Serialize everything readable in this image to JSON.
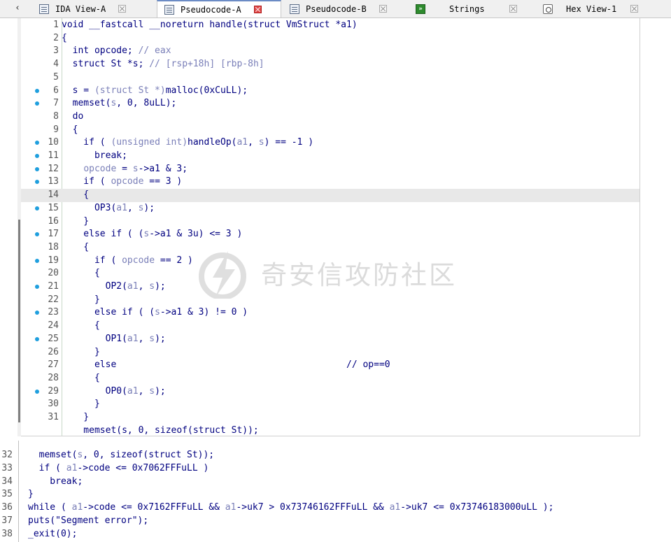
{
  "tabs": [
    {
      "label": "IDA View-A",
      "icon": "doc-icon",
      "active": false
    },
    {
      "label": "Pseudocode-A",
      "icon": "doc-icon",
      "active": true
    },
    {
      "label": "Pseudocode-B",
      "icon": "doc-icon",
      "active": false
    },
    {
      "label": "Strings",
      "icon": "strings-icon",
      "active": false
    },
    {
      "label": "Hex View-1",
      "icon": "hex-icon",
      "active": false
    }
  ],
  "editor": {
    "lines": [
      {
        "n": "1",
        "dot": false,
        "segs": [
          [
            "void __fastcall __noreturn handle(struct VmStruct *a1)",
            "d"
          ]
        ]
      },
      {
        "n": "2",
        "dot": false,
        "segs": [
          [
            "{",
            "d"
          ]
        ]
      },
      {
        "n": "3",
        "dot": false,
        "segs": [
          [
            "  int opcode; ",
            "d"
          ],
          [
            "// eax",
            "g"
          ]
        ]
      },
      {
        "n": "4",
        "dot": false,
        "segs": [
          [
            "  struct St *s; ",
            "d"
          ],
          [
            "// [rsp+18h] [rbp-8h]",
            "g"
          ]
        ]
      },
      {
        "n": "5",
        "dot": false,
        "segs": [
          [
            "",
            "d"
          ]
        ]
      },
      {
        "n": "6",
        "dot": true,
        "segs": [
          [
            "  s = ",
            "d"
          ],
          [
            "(struct St *)",
            "g"
          ],
          [
            "malloc(0xCuLL);",
            "d"
          ]
        ]
      },
      {
        "n": "7",
        "dot": true,
        "segs": [
          [
            "  memset(",
            "d"
          ],
          [
            "s",
            "g"
          ],
          [
            ", 0, 8uLL);",
            "d"
          ]
        ]
      },
      {
        "n": "8",
        "dot": false,
        "segs": [
          [
            "  do",
            "d"
          ]
        ]
      },
      {
        "n": "9",
        "dot": false,
        "segs": [
          [
            "  {",
            "d"
          ]
        ]
      },
      {
        "n": "10",
        "dot": true,
        "segs": [
          [
            "    if ( ",
            "d"
          ],
          [
            "(unsigned int)",
            "g"
          ],
          [
            "handleOp(",
            "d"
          ],
          [
            "a1",
            "g"
          ],
          [
            ", ",
            "d"
          ],
          [
            "s",
            "g"
          ],
          [
            ") == -1 )",
            "d"
          ]
        ]
      },
      {
        "n": "11",
        "dot": true,
        "segs": [
          [
            "      break;",
            "d"
          ]
        ]
      },
      {
        "n": "12",
        "dot": true,
        "segs": [
          [
            "    ",
            "d"
          ],
          [
            "opcode",
            "g"
          ],
          [
            " = ",
            "d"
          ],
          [
            "s",
            "g"
          ],
          [
            "->a1 & 3;",
            "d"
          ]
        ]
      },
      {
        "n": "13",
        "dot": true,
        "segs": [
          [
            "    if ( ",
            "d"
          ],
          [
            "opcode",
            "g"
          ],
          [
            " == 3 )",
            "d"
          ]
        ]
      },
      {
        "n": "14",
        "dot": false,
        "hl": true,
        "segs": [
          [
            "    {",
            "d"
          ]
        ]
      },
      {
        "n": "15",
        "dot": true,
        "segs": [
          [
            "      OP3(",
            "d"
          ],
          [
            "a1",
            "g"
          ],
          [
            ", ",
            "d"
          ],
          [
            "s",
            "g"
          ],
          [
            ");",
            "d"
          ]
        ]
      },
      {
        "n": "16",
        "dot": false,
        "segs": [
          [
            "    }",
            "d"
          ]
        ]
      },
      {
        "n": "17",
        "dot": true,
        "segs": [
          [
            "    else if ( (",
            "d"
          ],
          [
            "s",
            "g"
          ],
          [
            "->a1 & 3u) <= 3 )",
            "d"
          ]
        ]
      },
      {
        "n": "18",
        "dot": false,
        "segs": [
          [
            "    {",
            "d"
          ]
        ]
      },
      {
        "n": "19",
        "dot": true,
        "segs": [
          [
            "      if ( ",
            "d"
          ],
          [
            "opcode",
            "g"
          ],
          [
            " == 2 )",
            "d"
          ]
        ]
      },
      {
        "n": "20",
        "dot": false,
        "segs": [
          [
            "      {",
            "d"
          ]
        ]
      },
      {
        "n": "21",
        "dot": true,
        "segs": [
          [
            "        OP2(",
            "d"
          ],
          [
            "a1",
            "g"
          ],
          [
            ", ",
            "d"
          ],
          [
            "s",
            "g"
          ],
          [
            ");",
            "d"
          ]
        ]
      },
      {
        "n": "22",
        "dot": false,
        "segs": [
          [
            "      }",
            "d"
          ]
        ]
      },
      {
        "n": "23",
        "dot": true,
        "segs": [
          [
            "      else if ( (",
            "d"
          ],
          [
            "s",
            "g"
          ],
          [
            "->a1 & 3) != 0 )",
            "d"
          ]
        ]
      },
      {
        "n": "24",
        "dot": false,
        "segs": [
          [
            "      {",
            "d"
          ]
        ]
      },
      {
        "n": "25",
        "dot": true,
        "segs": [
          [
            "        OP1(",
            "d"
          ],
          [
            "a1",
            "g"
          ],
          [
            ", ",
            "d"
          ],
          [
            "s",
            "g"
          ],
          [
            ");",
            "d"
          ]
        ]
      },
      {
        "n": "26",
        "dot": false,
        "segs": [
          [
            "      }",
            "d"
          ]
        ]
      },
      {
        "n": "27",
        "dot": false,
        "segs": [
          [
            "      else                                          // op==0",
            "d"
          ]
        ]
      },
      {
        "n": "28",
        "dot": false,
        "segs": [
          [
            "      {",
            "d"
          ]
        ]
      },
      {
        "n": "29",
        "dot": true,
        "segs": [
          [
            "        OP0(",
            "d"
          ],
          [
            "a1",
            "g"
          ],
          [
            ", ",
            "d"
          ],
          [
            "s",
            "g"
          ],
          [
            ");",
            "d"
          ]
        ]
      },
      {
        "n": "30",
        "dot": false,
        "segs": [
          [
            "      }",
            "d"
          ]
        ]
      },
      {
        "n": "31",
        "dot": false,
        "segs": [
          [
            "    }",
            "d"
          ]
        ]
      },
      {
        "n": "",
        "dot": false,
        "segs": [
          [
            "    memset(s, 0, sizeof(struct St));",
            "d"
          ]
        ]
      }
    ]
  },
  "bottom": {
    "lines": [
      {
        "n": "32",
        "segs": [
          [
            "  memset(",
            "d"
          ],
          [
            "s",
            "g"
          ],
          [
            ", 0, sizeof(struct St));",
            "d"
          ]
        ]
      },
      {
        "n": "33",
        "segs": [
          [
            "  if ( ",
            "d"
          ],
          [
            "a1",
            "g"
          ],
          [
            "->code <= 0x7062FFFuLL )",
            "d"
          ]
        ]
      },
      {
        "n": "34",
        "segs": [
          [
            "    break;",
            "d"
          ]
        ]
      },
      {
        "n": "35",
        "segs": [
          [
            "}",
            "d"
          ]
        ]
      },
      {
        "n": "36",
        "segs": [
          [
            "while ( ",
            "d"
          ],
          [
            "a1",
            "g"
          ],
          [
            "->code <= 0x7162FFFuLL && ",
            "d"
          ],
          [
            "a1",
            "g"
          ],
          [
            "->uk7 > 0x73746162FFFuLL && ",
            "d"
          ],
          [
            "a1",
            "g"
          ],
          [
            "->uk7 <= 0x73746183000uLL );",
            "d"
          ]
        ]
      },
      {
        "n": "37",
        "segs": [
          [
            "puts(\"Segment error\");",
            "d"
          ]
        ]
      },
      {
        "n": "38",
        "segs": [
          [
            "_exit(0);",
            "d"
          ]
        ]
      }
    ]
  },
  "watermark": {
    "text": "奇安信攻防社区"
  },
  "colors": {
    "keyword_dark": "#000080",
    "variable_grey": "#7a7fb8",
    "breakpoint_dot": "#1f9fde",
    "close_red": "#e04848"
  }
}
